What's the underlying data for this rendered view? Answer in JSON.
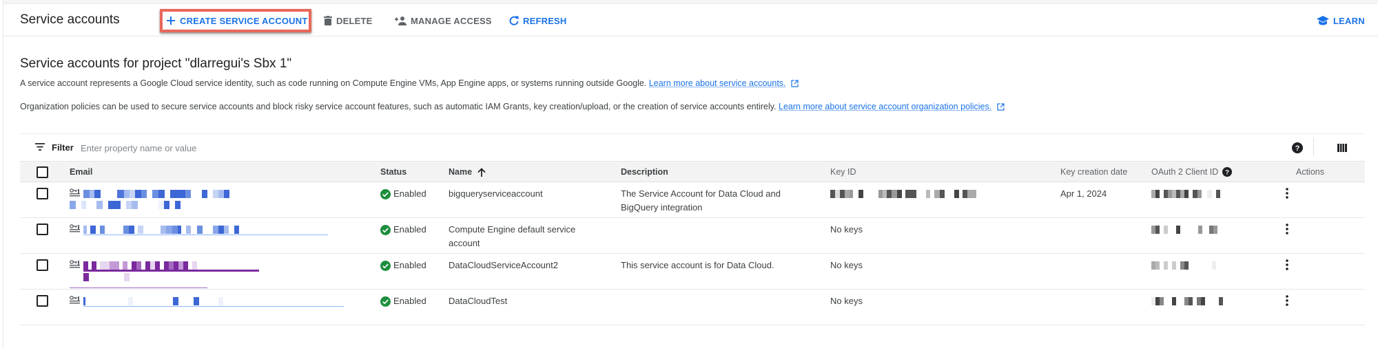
{
  "toolbar": {
    "title": "Service accounts",
    "create_label": "CREATE SERVICE ACCOUNT",
    "delete_label": "DELETE",
    "manage_access_label": "MANAGE ACCESS",
    "refresh_label": "REFRESH",
    "learn_label": "LEARN"
  },
  "heading": {
    "title": "Service accounts for project \"dlarregui's Sbx 1\"",
    "desc1_text": "A service account represents a Google Cloud service identity, such as code running on Compute Engine VMs, App Engine apps, or systems running outside Google.",
    "desc1_link": "Learn more about service accounts.",
    "desc2_text": "Organization policies can be used to secure service accounts and block risky service account features, such as automatic IAM Grants, key creation/upload, or the creation of service accounts entirely.",
    "desc2_link": "Learn more about service account organization policies."
  },
  "filter": {
    "label": "Filter",
    "placeholder": "Enter property name or value",
    "value": ""
  },
  "table": {
    "columns": {
      "email": "Email",
      "status": "Status",
      "name": "Name",
      "description": "Description",
      "key_id": "Key ID",
      "key_creation_date": "Key creation date",
      "oauth_client_id": "OAuth 2 Client ID",
      "actions": "Actions"
    },
    "sort": {
      "column": "name",
      "direction": "ascending"
    },
    "rows": [
      {
        "email": "[redacted]",
        "status": "Enabled",
        "name": "bigqueryserviceaccount",
        "description": "The Service Account for Data Cloud and BigQuery integration",
        "key_id": "[redacted]",
        "key_creation_date": "Apr 1, 2024",
        "oauth_client_id": "[redacted]"
      },
      {
        "email": "[redacted]",
        "status": "Enabled",
        "name": "Compute Engine default service account",
        "description": "",
        "key_id": "No keys",
        "key_creation_date": "",
        "oauth_client_id": "[redacted]"
      },
      {
        "email": "[redacted]",
        "status": "Enabled",
        "name": "DataCloudServiceAccount2",
        "description": "This service account is for Data Cloud.",
        "key_id": "No keys",
        "key_creation_date": "",
        "oauth_client_id": "[redacted]"
      },
      {
        "email": "[redacted]",
        "status": "Enabled",
        "name": "DataCloudTest",
        "description": "",
        "key_id": "No keys",
        "key_creation_date": "",
        "oauth_client_id": "[redacted]"
      }
    ]
  },
  "icons": {
    "create": "plus-icon",
    "delete": "trash-icon",
    "manage_access": "person-add-icon",
    "refresh": "refresh-icon",
    "learn": "school-cap-icon",
    "filter": "filter-lines-icon",
    "help": "help-circle-icon",
    "columns": "column-display-icon",
    "service_account": "service-account-key-icon",
    "status_enabled": "check-circle-icon",
    "row_actions": "more-vert-icon",
    "external_link": "open-in-new-icon",
    "sort": "arrow-up-icon"
  },
  "colors": {
    "primary": "#1a73e8",
    "highlight_border": "#e8695a",
    "status_ok": "#1e8e3e",
    "visited_link": "#7b2a9e"
  }
}
